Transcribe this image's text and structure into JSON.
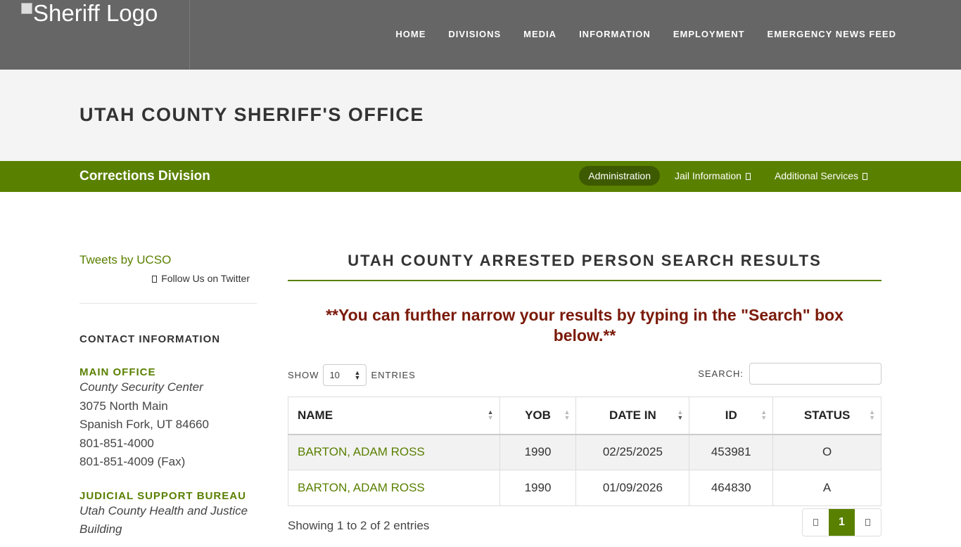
{
  "header": {
    "logo_alt": "Sheriff Logo",
    "nav": [
      "HOME",
      "DIVISIONS",
      "MEDIA",
      "INFORMATION",
      "EMPLOYMENT",
      "EMERGENCY NEWS FEED"
    ]
  },
  "title_band": {
    "title": "UTAH COUNTY SHERIFF'S OFFICE"
  },
  "division_bar": {
    "name": "Corrections Division",
    "items": [
      "Administration",
      "Jail Information",
      "Additional Services"
    ]
  },
  "sidebar": {
    "tweets_link": "Tweets by UCSO",
    "follow": "Follow Us on Twitter",
    "contact_heading": "CONTACT INFORMATION",
    "main_office": {
      "heading": "MAIN OFFICE",
      "building": "County Security Center",
      "street": "3075 North Main",
      "city": "Spanish Fork, UT 84660",
      "phone": "801-851-4000",
      "fax": "801-851-4009 (Fax)"
    },
    "judicial": {
      "heading": "JUDICIAL SUPPORT BUREAU",
      "building": "Utah County Health and Justice",
      "building2": "Building"
    }
  },
  "main": {
    "heading": "UTAH COUNTY ARRESTED PERSON SEARCH RESULTS",
    "notice": "**You can further narrow your results by typing in the \"Search\" box below.**",
    "show_label": "SHOW",
    "entries_value": "10",
    "entries_label": "ENTRIES",
    "search_label": "SEARCH:",
    "search_value": "",
    "columns": [
      "NAME",
      "YOB",
      "DATE IN",
      "ID",
      "STATUS"
    ],
    "rows": [
      {
        "name": "BARTON, ADAM ROSS",
        "yob": "1990",
        "date_in": "02/25/2025",
        "id": "453981",
        "status": "O"
      },
      {
        "name": "BARTON, ADAM ROSS",
        "yob": "1990",
        "date_in": "01/09/2026",
        "id": "464830",
        "status": "A"
      }
    ],
    "info": "Showing 1 to 2 of 2 entries",
    "current_page": "1"
  },
  "colors": {
    "header": "#666666",
    "accent_green": "#5a8000",
    "notice_red": "#7a1a0a"
  }
}
